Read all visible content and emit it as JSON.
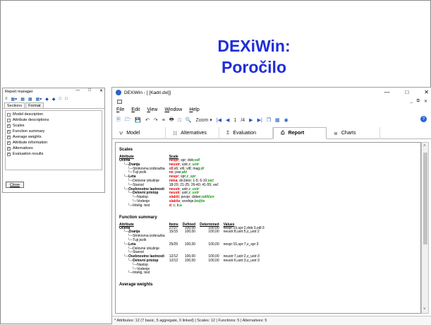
{
  "slide": {
    "title_line1": "DEXiWin:",
    "title_line2": "Poročilo"
  },
  "report_manager": {
    "title": "Report manager",
    "tabs": [
      "Sections",
      "Format"
    ],
    "items": [
      {
        "label": "Model description",
        "checked": false
      },
      {
        "label": "Attribute descriptions",
        "checked": false
      },
      {
        "label": "Scales",
        "checked": true
      },
      {
        "label": "Function summary",
        "checked": true
      },
      {
        "label": "Average weights",
        "checked": true
      },
      {
        "label": "Attribute information",
        "checked": true
      },
      {
        "label": "Alternatives",
        "checked": true
      },
      {
        "label": "Evaluation results",
        "checked": true
      }
    ],
    "close_label": "Close"
  },
  "window": {
    "title": "DEXiWin - [ [Kadri.dxi]]",
    "menu": [
      "File",
      "Edit",
      "View",
      "Window",
      "Help"
    ],
    "toolbar": {
      "zoom_label": "Zoom",
      "page": "1",
      "page_total": "/4"
    },
    "tabs": [
      {
        "label": "Model",
        "icon": "model-icon"
      },
      {
        "label": "Alternatives",
        "icon": "alternatives-icon"
      },
      {
        "label": "Evaluation",
        "icon": "sigma-icon"
      },
      {
        "label": "Report",
        "icon": "report-icon",
        "active": true
      },
      {
        "label": "Charts",
        "icon": "charts-icon"
      }
    ],
    "status": "* Attributes: 12 (7 basic, 5 aggregate, 0 linked) | Scales: 12 | Functions: 5 | Alternatives: 5"
  },
  "report": {
    "scales": {
      "heading": "Scales",
      "col_attribute": "Attribute",
      "col_scale": "Scale",
      "rows": [
        {
          "attr": "Ocena",
          "level": 0,
          "bold": true,
          "neg": "nespr",
          "mid": "; spr; dob;",
          "pos": "odl"
        },
        {
          "attr": "Znanja",
          "level": 1,
          "bold": true,
          "neg": "neustr",
          "mid": "; ustr;",
          "pos": "z_ustr"
        },
        {
          "attr": "Strokovna izobrazba",
          "level": 2,
          "bold": false,
          "neg": "o5",
          "mid": ";s6; vi6; vi8; mag;",
          "pos": "dr"
        },
        {
          "attr": "Tuji jezik",
          "level": 2,
          "bold": false,
          "neg": "ne",
          "mid": "; pas;",
          "pos": "akt"
        },
        {
          "attr": "Leta",
          "level": 1,
          "bold": true,
          "neg": "nespr",
          "mid": "; spr;",
          "pos": "z_spr"
        },
        {
          "attr": "Delovne izkušnje",
          "level": 2,
          "bold": false,
          "neg": "nima",
          "mid": "; do1leto; 1-5; 6-10;",
          "pos": "več"
        },
        {
          "attr": "Starost",
          "level": 2,
          "bold": false,
          "neg": "",
          "mid": "18-20; 21-25; 26-40; 41-55; več",
          "pos": ""
        },
        {
          "attr": "Osebnostne lastnosti",
          "level": 1,
          "bold": true,
          "neg": "neustr",
          "mid": "; ustr;",
          "pos": "z_ustr"
        },
        {
          "attr": "Delovni pristop",
          "level": 2,
          "bold": true,
          "neg": "neustr",
          "mid": "; ustr;",
          "pos": "z_ustr"
        },
        {
          "attr": "Nastop",
          "level": 3,
          "bold": false,
          "neg": "slabši",
          "mid": "; povpr; dober;",
          "pos": "odličen"
        },
        {
          "attr": "Vodenje",
          "level": 3,
          "bold": false,
          "neg": "slabše",
          "mid": "; srednje;",
          "pos": "boljše"
        },
        {
          "attr": "Intelig. test",
          "level": 2,
          "bold": false,
          "neg": "d",
          "mid": "; c; b;",
          "pos": "a"
        }
      ]
    },
    "functions": {
      "heading": "Function summary",
      "cols": [
        "Attribute",
        "Items",
        "Defined",
        "Determined",
        "Values"
      ],
      "rows": [
        {
          "attr": "Ocena",
          "level": 0,
          "bold": true,
          "items": "27/27",
          "defined": "100,00",
          "determined": "100,00",
          "values": "nespr:19,spr:2,dob:3,odl:3"
        },
        {
          "attr": "Znanja",
          "level": 1,
          "bold": true,
          "items": "15/15",
          "defined": "100,00",
          "determined": "100,00",
          "values": "neustr:8,ustr:5,z_ustr:2"
        },
        {
          "attr": "Strokovna izobrazba",
          "level": 2,
          "bold": false,
          "items": "",
          "defined": "",
          "determined": "",
          "values": ""
        },
        {
          "attr": "Tuji jezik",
          "level": 2,
          "bold": false,
          "items": "",
          "defined": "",
          "determined": "",
          "values": ""
        },
        {
          "attr": "Leta",
          "level": 1,
          "bold": true,
          "items": "25/25",
          "defined": "100,00",
          "determined": "100,00",
          "values": "nespr:15,spr:7,z_spr:3"
        },
        {
          "attr": "Delovne izkušnje",
          "level": 2,
          "bold": false,
          "items": "",
          "defined": "",
          "determined": "",
          "values": ""
        },
        {
          "attr": "Starost",
          "level": 2,
          "bold": false,
          "items": "",
          "defined": "",
          "determined": "",
          "values": ""
        },
        {
          "attr": "Osebnostne lastnosti",
          "level": 1,
          "bold": true,
          "items": "12/12",
          "defined": "100,00",
          "determined": "100,00",
          "values": "neustr:7,ustr:2,z_ustr:3"
        },
        {
          "attr": "Delovni pristop",
          "level": 2,
          "bold": true,
          "items": "12/12",
          "defined": "100,00",
          "determined": "100,00",
          "values": "neustr:6,ustr:3,z_ustr:3"
        },
        {
          "attr": "Nastop",
          "level": 3,
          "bold": false,
          "items": "",
          "defined": "",
          "determined": "",
          "values": ""
        },
        {
          "attr": "Vodenje",
          "level": 3,
          "bold": false,
          "items": "",
          "defined": "",
          "determined": "",
          "values": ""
        },
        {
          "attr": "Intelig. test",
          "level": 2,
          "bold": false,
          "items": "",
          "defined": "",
          "determined": "",
          "values": ""
        }
      ]
    },
    "weights_heading": "Average weights"
  },
  "colors": {
    "title": "#1f2ed8",
    "bad": "#e00000",
    "good": "#0a9a0a"
  }
}
